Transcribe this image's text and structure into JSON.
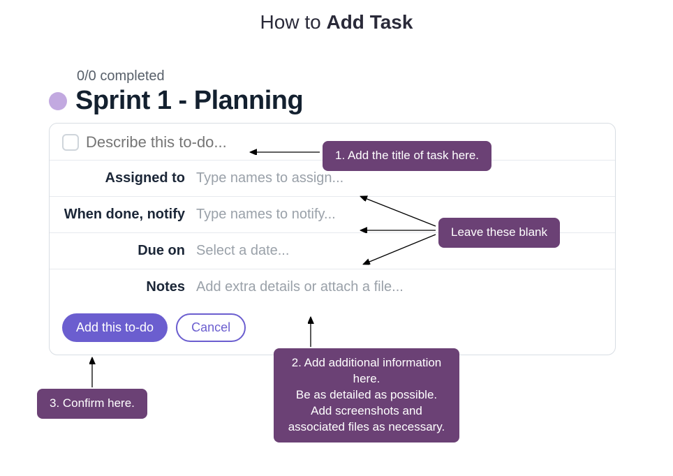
{
  "page_title_prefix": "How to ",
  "page_title_bold": "Add Task",
  "completed_text": "0/0 completed",
  "sprint_title": "Sprint 1 - Planning",
  "title_placeholder": "Describe this to-do...",
  "fields": {
    "assigned": {
      "label": "Assigned to",
      "placeholder": "Type names to assign..."
    },
    "notify": {
      "label": "When done, notify",
      "placeholder": "Type names to notify..."
    },
    "due": {
      "label": "Due on",
      "placeholder": "Select a date..."
    },
    "notes": {
      "label": "Notes",
      "placeholder": "Add extra details or attach a file..."
    }
  },
  "buttons": {
    "add": "Add this to-do",
    "cancel": "Cancel"
  },
  "callouts": {
    "c1": "1. Add the title of task here.",
    "c2": "2. Add additional information here.\nBe as detailed as possible.\nAdd screenshots and\nassociated files as necessary.",
    "c3": "3. Confirm here.",
    "c4": "Leave these blank"
  }
}
